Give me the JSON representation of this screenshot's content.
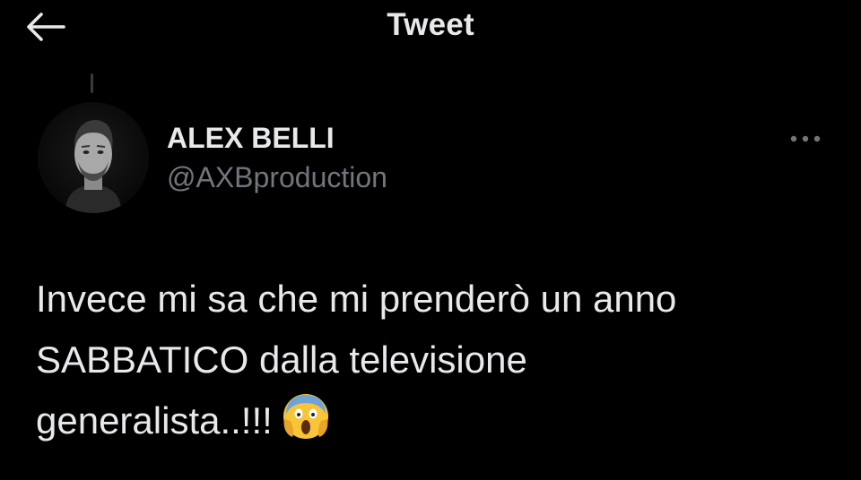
{
  "header": {
    "title": "Tweet",
    "back_icon": "arrow-left-icon"
  },
  "tweet": {
    "author_name": "ALEX BELLI",
    "author_handle": "@AXBproduction",
    "more_icon": "more-horizontal-icon",
    "text_lines": [
      "Invece mi sa che mi prenderò un anno",
      "SABBATICO dalla televisione",
      "generalista..!!!"
    ],
    "emoji": "face-screaming-in-fear",
    "emoji_char": "😱"
  },
  "colors": {
    "background": "#000000",
    "primary_text": "#e7e9ea",
    "secondary_text": "#71767b",
    "emoji_face": "#f7c536"
  }
}
